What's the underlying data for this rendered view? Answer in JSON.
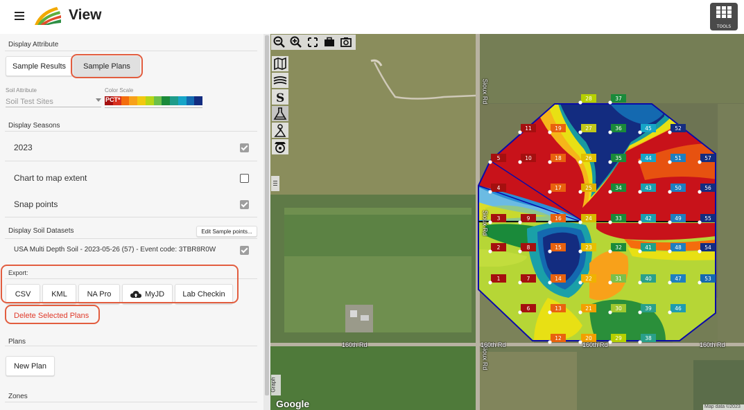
{
  "header": {
    "title": "View",
    "tools_label": "TOOLS"
  },
  "display_attribute": {
    "title": "Display Attribute",
    "tabs": [
      "Sample Results",
      "Sample Plans"
    ],
    "selected_tab": "Sample Plans"
  },
  "soil_attribute": {
    "label": "Soil Attribute",
    "value": "Soil Test Sites"
  },
  "color_scale": {
    "label": "Color Scale",
    "value": "PCT*",
    "colors": [
      "#a50f0f",
      "#d7301f",
      "#f46d0d",
      "#f8a11a",
      "#f2c80f",
      "#b5d617",
      "#6cc04a",
      "#1a8a3a",
      "#1f9c8a",
      "#16a5c8",
      "#1469b0",
      "#132c80"
    ]
  },
  "display_seasons": {
    "title": "Display Seasons",
    "seasons": [
      {
        "label": "2023",
        "checked": true
      }
    ]
  },
  "options": [
    {
      "label": "Chart to map extent",
      "checked": false
    },
    {
      "label": "Snap points",
      "checked": true
    }
  ],
  "soil_datasets": {
    "title": "Display Soil Datasets",
    "edit_button": "Edit Sample points...",
    "items": [
      {
        "label": "USA Multi Depth Soil - 2023-05-26 (57) - Event code: 3TBR8R0W",
        "checked": true
      }
    ]
  },
  "export": {
    "title": "Export:",
    "buttons": [
      "CSV",
      "KML",
      "NA Pro",
      "MyJD",
      "Lab Checkin"
    ]
  },
  "delete_button": "Delete Selected Plans",
  "plans": {
    "title": "Plans",
    "new_button": "New Plan"
  },
  "zones": {
    "title": "Zones"
  },
  "map": {
    "roads": {
      "sioux_top": "Sioux Rd",
      "sioux_mid": "Sioux Rd",
      "sioux_bottom": "Sioux Rd",
      "road_160_left": "160th Rd",
      "road_160_mid": "160th Rd",
      "road_160_center": "160th Rd",
      "road_160_right": "160th Rd"
    },
    "google_logo": "Google",
    "attribution": "Map data ©2023",
    "graph_tab": "Graph",
    "colors": {
      "boundary": "#0a0aa8",
      "grid_line": "#111111"
    },
    "sample_labels": {
      "c1": [
        "1",
        "2",
        "3",
        "4",
        "5"
      ],
      "c2": [
        "6",
        "7",
        "8",
        "9",
        "10",
        "11"
      ],
      "c3": [
        "12",
        "13",
        "14",
        "15",
        "16",
        "17",
        "18",
        "19"
      ],
      "c4": [
        "20",
        "21",
        "22",
        "23",
        "24",
        "25",
        "26",
        "27",
        "28"
      ],
      "c5": [
        "29",
        "30",
        "31",
        "32",
        "33",
        "34",
        "35",
        "36",
        "37"
      ],
      "c6": [
        "38",
        "39",
        "40",
        "41",
        "42",
        "43",
        "44",
        "45"
      ],
      "c7": [
        "46",
        "47",
        "48",
        "49",
        "50",
        "51",
        "52"
      ],
      "c8": [
        "53",
        "54",
        "55",
        "56",
        "57"
      ]
    }
  }
}
